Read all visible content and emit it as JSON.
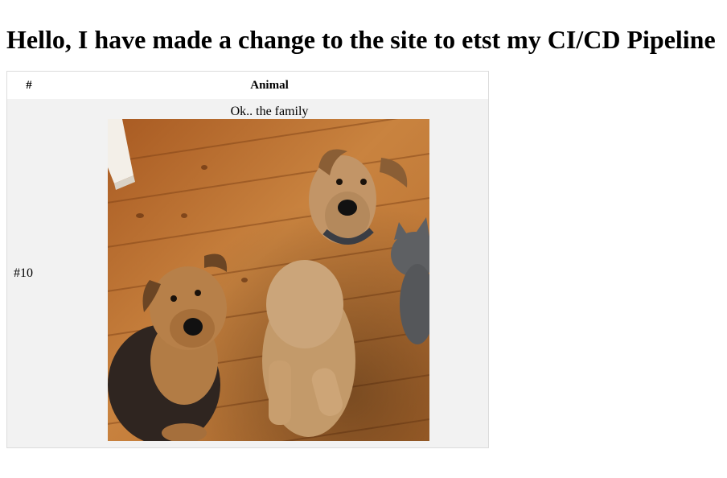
{
  "page": {
    "heading": "Hello, I have made a change to the site to etst my CI/CD Pipeline"
  },
  "table": {
    "headers": {
      "number": "#",
      "animal": "Animal"
    },
    "rows": [
      {
        "number": "#10",
        "caption": "Ok.. the family",
        "image": "photo of two airedale terriers and a grey cat on a wooden floor"
      }
    ]
  },
  "colors": {
    "row_background": "#f2f2f2",
    "border": "#dcdcdc",
    "floor_wood": "#b8732f"
  }
}
